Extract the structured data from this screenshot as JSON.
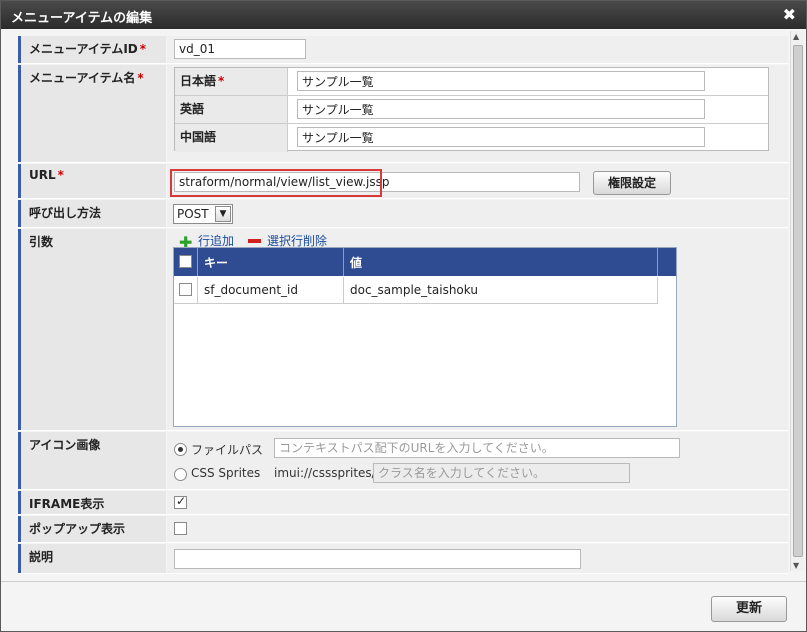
{
  "dialog": {
    "title": "メニューアイテムの編集",
    "close_label": "✖"
  },
  "fields": {
    "id": {
      "label": "メニューアイテムID",
      "required_mark": "*",
      "value": "vd_01"
    },
    "name": {
      "label": "メニューアイテム名",
      "required_mark": "*",
      "languages": [
        {
          "label": "日本語",
          "required_mark": "*",
          "value": "サンプル一覧"
        },
        {
          "label": "英語",
          "required_mark": "",
          "value": "サンプル一覧"
        },
        {
          "label": "中国語",
          "required_mark": "",
          "value": "サンプル一覧"
        }
      ]
    },
    "url": {
      "label": "URL",
      "required_mark": "*",
      "value": "straform/normal/view/list_view.jssp",
      "permission_button": "権限設定"
    },
    "method": {
      "label": "呼び出し方法",
      "selected": "POST",
      "arrow": "▼"
    },
    "args": {
      "label": "引数",
      "add_label": "行追加",
      "delete_label": "選択行削除",
      "columns": [
        "キー",
        "値"
      ],
      "rows": [
        {
          "key": "sf_document_id",
          "value": "doc_sample_taishoku"
        }
      ]
    },
    "icon": {
      "label": "アイコン画像",
      "filepath_label": "ファイルパス",
      "filepath_placeholder": "コンテキストパス配下のURLを入力してください。",
      "sprites_label": "CSS Sprites",
      "sprites_prefix": "imui://csssprites/",
      "sprites_placeholder": "クラス名を入力してください。",
      "selected": "filepath"
    },
    "iframe": {
      "label": "IFRAME表示",
      "checked": true
    },
    "popup": {
      "label": "ポップアップ表示",
      "checked": false
    },
    "description": {
      "label": "説明",
      "value": ""
    }
  },
  "footer": {
    "update_button": "更新"
  },
  "colors": {
    "accent": "#3b5ca8",
    "grid_header": "#2f4b91",
    "highlight": "#d63a3a"
  }
}
